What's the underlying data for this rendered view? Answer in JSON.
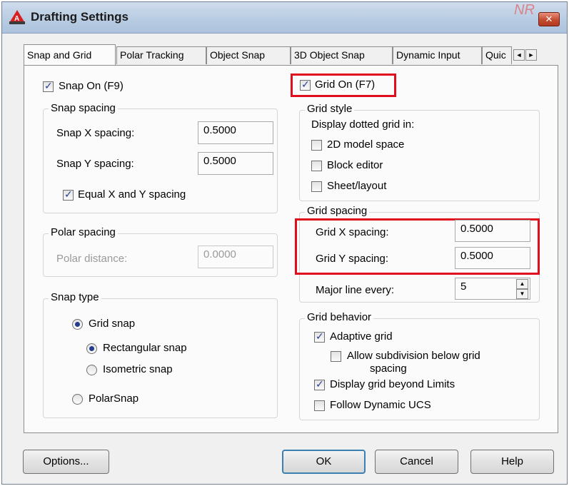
{
  "window": {
    "title": "Drafting Settings",
    "close_glyph": "✕"
  },
  "watermark": "NR",
  "tabs": [
    {
      "label": "Snap and Grid"
    },
    {
      "label": "Polar Tracking"
    },
    {
      "label": "Object Snap"
    },
    {
      "label": "3D Object Snap"
    },
    {
      "label": "Dynamic Input"
    },
    {
      "label": "Quic"
    }
  ],
  "tab_scroll": {
    "left": "◄",
    "right": "►"
  },
  "snap": {
    "snap_on": {
      "label": "Snap On (F9)",
      "checked": true
    },
    "spacing_group": "Snap spacing",
    "x_label": "Snap X spacing:",
    "x_value": "0.5000",
    "y_label": "Snap Y spacing:",
    "y_value": "0.5000",
    "equal": {
      "label": "Equal X and Y spacing",
      "checked": true
    },
    "polar_group": "Polar spacing",
    "polar_label": "Polar distance:",
    "polar_value": "0.0000",
    "type_group": "Snap type",
    "grid_snap": "Grid snap",
    "rect_snap": "Rectangular snap",
    "iso_snap": "Isometric snap",
    "polar_snap": "PolarSnap"
  },
  "grid": {
    "grid_on": {
      "label": "Grid On (F7)",
      "checked": true
    },
    "style_group": "Grid style",
    "style_caption": "Display dotted grid in:",
    "model_space": "2D model space",
    "block_editor": "Block editor",
    "sheet_layout": "Sheet/layout",
    "spacing_group": "Grid spacing",
    "x_label": "Grid X spacing:",
    "x_value": "0.5000",
    "y_label": "Grid Y spacing:",
    "y_value": "0.5000",
    "major_label": "Major line every:",
    "major_value": "5",
    "behavior_group": "Grid behavior",
    "adaptive": "Adaptive grid",
    "subdivision_1": "Allow subdivision below grid",
    "subdivision_2": "spacing",
    "beyond_limits": "Display grid beyond Limits",
    "follow_ucs": "Follow Dynamic UCS"
  },
  "buttons": {
    "options": "Options...",
    "ok": "OK",
    "cancel": "Cancel",
    "help": "Help"
  },
  "colors": {
    "highlight": "#e00d1d",
    "title_bar": "#b7cbe2",
    "check": "#263f8f"
  }
}
